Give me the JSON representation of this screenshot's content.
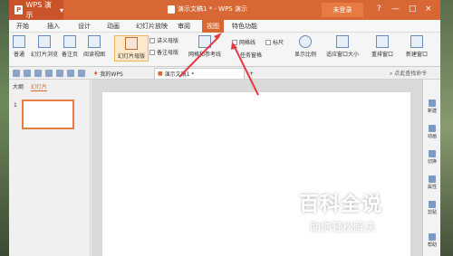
{
  "window": {
    "app_label": "WPS 演示",
    "doc_title": "演示文稿1 * - WPS 演示",
    "login_label": "未登录",
    "controls": [
      "?",
      "—",
      "□",
      "×"
    ]
  },
  "tabs": [
    {
      "label": "开始",
      "active": false
    },
    {
      "label": "插入",
      "active": false
    },
    {
      "label": "设计",
      "active": false
    },
    {
      "label": "动画",
      "active": false
    },
    {
      "label": "幻灯片放映",
      "active": false
    },
    {
      "label": "审阅",
      "active": false
    },
    {
      "label": "视图",
      "active": true
    },
    {
      "label": "特色功能",
      "active": false
    }
  ],
  "ribbon": {
    "normal": "普通",
    "slide_sorter": "幻灯片浏览",
    "notes_page": "备注页",
    "reading_view": "阅读视图",
    "slide_master": "幻灯片母版",
    "handout_master": "讲义母版",
    "notes_master": "备注母版",
    "grid_guides": "网格和参考线",
    "task_pane": "任务窗格",
    "gridlines": "网格线",
    "ruler": "标尺",
    "zoom": "显示比例",
    "fit_window": "适应窗口大小",
    "arrange": "重排窗口",
    "new_window": "新建窗口"
  },
  "quickbar": {
    "my_wps": "我的WPS",
    "doc_tab": "演示文稿1 *",
    "search_label": "点此查找命令"
  },
  "left_panel": {
    "tab_outline": "大纲",
    "tab_slides": "幻灯片",
    "slide_number": "1"
  },
  "right_bar": [
    "新建",
    "动画",
    "切换",
    "属性",
    "剪贴",
    "帮助"
  ],
  "watermark": {
    "main": "百科全说",
    "sub": "助你轻松解决"
  },
  "colors": {
    "accent": "#d76735",
    "highlight": "#fde9c9",
    "arrow": "#e63946"
  }
}
